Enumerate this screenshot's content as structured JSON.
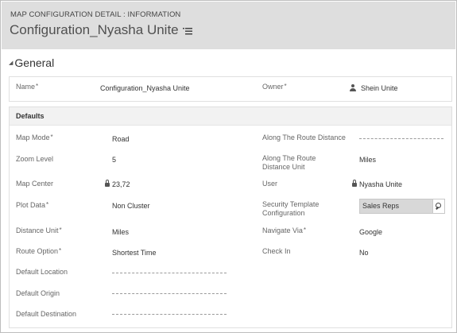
{
  "header": {
    "breadcrumb": "MAP CONFIGURATION DETAIL : INFORMATION",
    "title": "Configuration_Nyasha Unite",
    "menu_icon": "list-menu-icon"
  },
  "general": {
    "section_title": "General",
    "name": {
      "label": "Name",
      "required": "*",
      "value": "Configuration_Nyasha Unite"
    },
    "owner": {
      "label": "Owner",
      "required": "*",
      "value": "Shein Unite",
      "icon": "person-icon"
    }
  },
  "defaults": {
    "section_title": "Defaults",
    "left": [
      {
        "label": "Map Mode",
        "required": "*",
        "value": "Road"
      },
      {
        "label": "Zoom Level",
        "required": "",
        "value": "5"
      },
      {
        "label": "Map Center",
        "required": "",
        "value": "23,72",
        "icon": "lock-icon"
      },
      {
        "label": "Plot Data",
        "required": "*",
        "value": "Non Cluster"
      },
      {
        "label": "Distance Unit",
        "required": "*",
        "value": "Miles"
      },
      {
        "label": "Route Option",
        "required": "*",
        "value": "Shortest Time"
      },
      {
        "label": "Default Location",
        "required": "",
        "value": ""
      },
      {
        "label": "Default Origin",
        "required": "",
        "value": ""
      },
      {
        "label": "Default Destination",
        "required": "",
        "value": ""
      }
    ],
    "right": [
      {
        "label": "Along The Route Distance",
        "required": "",
        "value": ""
      },
      {
        "label": "Along The Route Distance Unit",
        "required": "",
        "value": "Miles"
      },
      {
        "label": "User",
        "required": "",
        "value": "Nyasha Unite",
        "icon": "lock-icon"
      },
      {
        "label": "Security Template Configuration",
        "required": "",
        "value": "Sales Reps",
        "icon": "search-icon"
      },
      {
        "label": "Navigate Via",
        "required": "*",
        "value": "Google"
      },
      {
        "label": "Check In",
        "required": "",
        "value": "No"
      }
    ]
  }
}
